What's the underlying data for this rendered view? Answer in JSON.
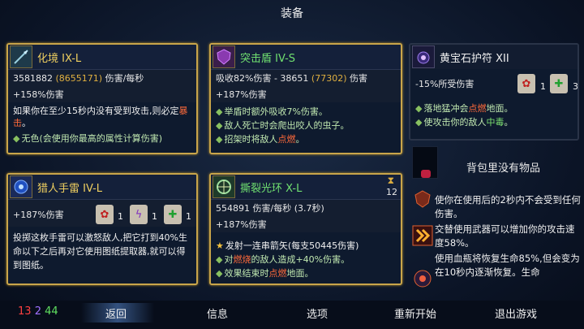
{
  "title": "装备",
  "cards": {
    "weapon": {
      "name": "化境 IX-L",
      "stat_main": "3581882",
      "stat_paren": "(8655171)",
      "stat_unit": "伤害/每秒",
      "stat_bonus": "+158%伤害",
      "desc_a": "如果你在至少15秒内没有受到攻击,则必定",
      "desc_red": "暴击",
      "desc_b": "。",
      "bullet": "无色(会使用你最高的属性计算伤害)"
    },
    "shield": {
      "name": "突击盾 IV-S",
      "stat_a": "吸收82%伤害 - 38651",
      "stat_paren": "(77302)",
      "stat_unit": "伤害",
      "stat_bonus": "+187%伤害",
      "bullet_1": "举盾时额外吸收7%伤害。",
      "bullet_2": "敌人死亡时会爬出咬人的虫子。",
      "bullet_3a": "招架时将敌人",
      "bullet_3red": "点燃",
      "bullet_3b": "。"
    },
    "amulet": {
      "name": "黄宝石护符 XII",
      "stat": "-15%所受伤害",
      "badge_1_count": "1",
      "badge_2_count": "3",
      "bullet_1a": "落地猛冲会",
      "bullet_1red": "点燃",
      "bullet_1b": "地面。",
      "bullet_2a": "使攻击你的敌人",
      "bullet_2red": "中毒",
      "bullet_2b": "。"
    },
    "grenade": {
      "name": "猎人手雷 IV-L",
      "stat_bonus": "+187%伤害",
      "badge_1_count": "1",
      "badge_2_count": "1",
      "badge_3_count": "1",
      "desc": "投掷这枚手雷可以激怒敌人,把它打到40%生命以下之后再对它使用图纸提取器,就可以得到图纸。"
    },
    "aura": {
      "name": "撕裂光环 X-L",
      "counter": "12",
      "stat": "554891 伤害/每秒 (3.7秒)",
      "stat_bonus": "+187%伤害",
      "bullet_1": "发射一连串箭矢(每支50445伤害)",
      "bullet_2a": "对",
      "bullet_2red": "燃烧",
      "bullet_2b": "的敌人造成+40%伤害。",
      "bullet_3a": "效果结束时",
      "bullet_3red": "点燃",
      "bullet_3b": "地面。"
    }
  },
  "backpack": {
    "empty_text": "背包里没有物品"
  },
  "mutations": [
    {
      "text": "使你在使用后的2秒内不会受到任何伤害。"
    },
    {
      "text": "交替使用武器可以增加你的攻击速度58%。"
    },
    {
      "text": "使用血瓶将恢复生命85%,但会变为在10秒内逐渐恢复。生命"
    }
  ],
  "footer": {
    "count_red": "13",
    "count_purple": "2",
    "count_green": "44",
    "back": "返回",
    "info": "信息",
    "options": "选项",
    "restart": "重新开始",
    "quit": "退出游戏"
  },
  "colors": {
    "gold_border": "#c9a54a",
    "red_text": "#ff6a3a",
    "highlight": "#e0b040"
  }
}
